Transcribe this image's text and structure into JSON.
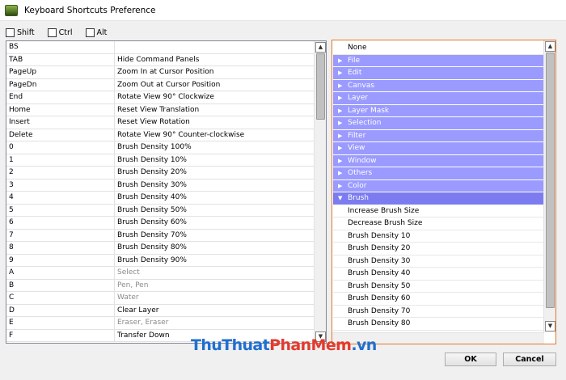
{
  "window": {
    "title": "Keyboard Shortcuts Preference"
  },
  "modifiers": [
    {
      "label": "Shift",
      "checked": false
    },
    {
      "label": "Ctrl",
      "checked": false
    },
    {
      "label": "Alt",
      "checked": false
    }
  ],
  "shortcuts": [
    {
      "key": "BS",
      "action": "",
      "dim": false
    },
    {
      "key": "TAB",
      "action": "Hide Command Panels",
      "dim": false
    },
    {
      "key": "PageUp",
      "action": "Zoom In at Cursor Position",
      "dim": false
    },
    {
      "key": "PageDn",
      "action": "Zoom Out at Cursor Position",
      "dim": false
    },
    {
      "key": "End",
      "action": "Rotate View 90° Clockwize",
      "dim": false
    },
    {
      "key": "Home",
      "action": "Reset View Translation",
      "dim": false
    },
    {
      "key": "Insert",
      "action": "Reset View Rotation",
      "dim": false
    },
    {
      "key": "Delete",
      "action": "Rotate View 90° Counter-clockwise",
      "dim": false
    },
    {
      "key": "0",
      "action": "Brush Density 100%",
      "dim": false
    },
    {
      "key": "1",
      "action": "Brush Density 10%",
      "dim": false
    },
    {
      "key": "2",
      "action": "Brush Density 20%",
      "dim": false
    },
    {
      "key": "3",
      "action": "Brush Density 30%",
      "dim": false
    },
    {
      "key": "4",
      "action": "Brush Density 40%",
      "dim": false
    },
    {
      "key": "5",
      "action": "Brush Density 50%",
      "dim": false
    },
    {
      "key": "6",
      "action": "Brush Density 60%",
      "dim": false
    },
    {
      "key": "7",
      "action": "Brush Density 70%",
      "dim": false
    },
    {
      "key": "8",
      "action": "Brush Density 80%",
      "dim": false
    },
    {
      "key": "9",
      "action": "Brush Density 90%",
      "dim": false
    },
    {
      "key": "A",
      "action": "Select",
      "dim": true
    },
    {
      "key": "B",
      "action": "Pen, Pen",
      "dim": true
    },
    {
      "key": "C",
      "action": "Water",
      "dim": true
    },
    {
      "key": "D",
      "action": "Clear Layer",
      "dim": false
    },
    {
      "key": "E",
      "action": "Eraser, Eraser",
      "dim": true
    },
    {
      "key": "F",
      "action": "Transfer Down",
      "dim": false
    }
  ],
  "commands": [
    {
      "label": "None",
      "type": "plain"
    },
    {
      "label": "File",
      "type": "group"
    },
    {
      "label": "Edit",
      "type": "group"
    },
    {
      "label": "Canvas",
      "type": "group"
    },
    {
      "label": "Layer",
      "type": "group"
    },
    {
      "label": "Layer Mask",
      "type": "group"
    },
    {
      "label": "Selection",
      "type": "group"
    },
    {
      "label": "Filter",
      "type": "group"
    },
    {
      "label": "View",
      "type": "group"
    },
    {
      "label": "Window",
      "type": "group"
    },
    {
      "label": "Others",
      "type": "group"
    },
    {
      "label": "Color",
      "type": "group"
    },
    {
      "label": "Brush",
      "type": "open"
    },
    {
      "label": "Increase Brush Size",
      "type": "plain"
    },
    {
      "label": "Decrease Brush Size",
      "type": "plain"
    },
    {
      "label": "Brush Density 10",
      "type": "plain"
    },
    {
      "label": "Brush Density 20",
      "type": "plain"
    },
    {
      "label": "Brush Density 30",
      "type": "plain"
    },
    {
      "label": "Brush Density 40",
      "type": "plain"
    },
    {
      "label": "Brush Density 50",
      "type": "plain"
    },
    {
      "label": "Brush Density 60",
      "type": "plain"
    },
    {
      "label": "Brush Density 70",
      "type": "plain"
    },
    {
      "label": "Brush Density 80",
      "type": "plain"
    }
  ],
  "buttons": {
    "ok": "OK",
    "cancel": "Cancel"
  },
  "watermark": {
    "part1": "ThuThuat",
    "part2": "PhanMem",
    "part3": ".vn"
  },
  "colors": {
    "group_bg": "#9a9aff",
    "group_open_bg": "#7c7cf0",
    "focus_border": "#e07a2e"
  },
  "icons": [
    "app-icon",
    "checkbox-icon",
    "scroll-up-icon",
    "scroll-down-icon",
    "expand-arrow-icon",
    "collapse-arrow-icon"
  ]
}
